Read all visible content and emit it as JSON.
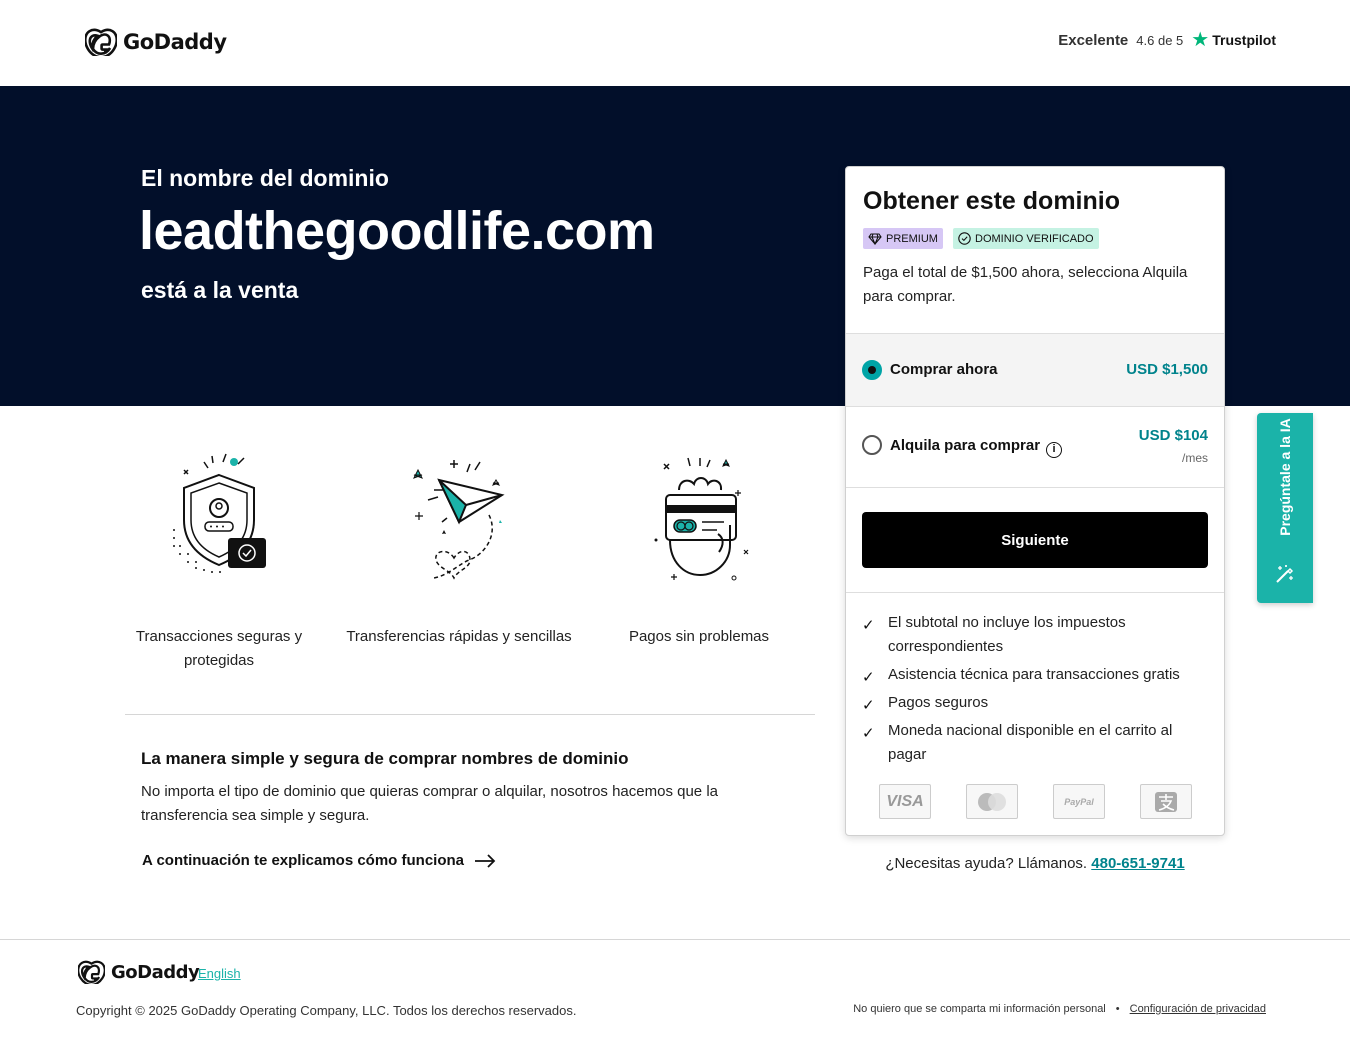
{
  "header": {
    "brand": "GoDaddy",
    "rating_word": "Excelente",
    "rating_score": "4.6 de 5",
    "rating_provider": "Trustpilot"
  },
  "hero": {
    "kicker": "El nombre del dominio",
    "domain": "leadthegoodlife.com",
    "status": "está a la venta"
  },
  "features": [
    {
      "icon": "secure-shield-icon",
      "caption": "Transacciones seguras y protegidas"
    },
    {
      "icon": "paper-plane-icon",
      "caption": "Transferencias rápidas y sencillas"
    },
    {
      "icon": "card-payment-icon",
      "caption": "Pagos sin problemas"
    }
  ],
  "simple": {
    "title": "La manera simple y segura de comprar nombres de dominio",
    "text": "No importa el tipo de dominio que quieras comprar o alquilar, nosotros hacemos que la transferencia sea simple y segura.",
    "link": "A continuación te explicamos cómo funciona"
  },
  "card": {
    "title": "Obtener este dominio",
    "badge_premium": "PREMIUM",
    "badge_verified": "DOMINIO VERIFICADO",
    "description": "Paga el total de $1,500 ahora, selecciona Alquila para comprar.",
    "options": [
      {
        "label": "Comprar ahora",
        "price": "USD $1,500",
        "selected": true
      },
      {
        "label": "Alquila para comprar",
        "price": "USD $104",
        "per": "/mes",
        "selected": false
      }
    ],
    "next_button": "Siguiente",
    "bullets": [
      "El subtotal no incluye los impuestos correspondientes",
      "Asistencia técnica para transacciones gratis",
      "Pagos seguros",
      "Moneda nacional disponible en el carrito al pagar"
    ],
    "payment_methods": [
      "VISA",
      "mastercard",
      "PayPal",
      "alipay"
    ]
  },
  "help": {
    "text": "¿Necesitas ayuda? Llámanos.",
    "phone": "480-651-9741"
  },
  "ai_tab": {
    "label": "Pregúntale a la IA"
  },
  "footer": {
    "brand": "GoDaddy",
    "language": "English",
    "copyright": "Copyright © 2025 GoDaddy Operating Company, LLC. Todos los derechos reservados.",
    "no_share": "No quiero que se comparta mi información personal",
    "privacy": "Configuración de privacidad"
  },
  "colors": {
    "hero_bg": "#020f2a",
    "accent_teal": "#00a4a6",
    "price_teal": "#00838c",
    "premium_badge": "#d6c7f5",
    "verified_badge": "#c5f2e3",
    "ai_tab": "#1bb3a9"
  }
}
